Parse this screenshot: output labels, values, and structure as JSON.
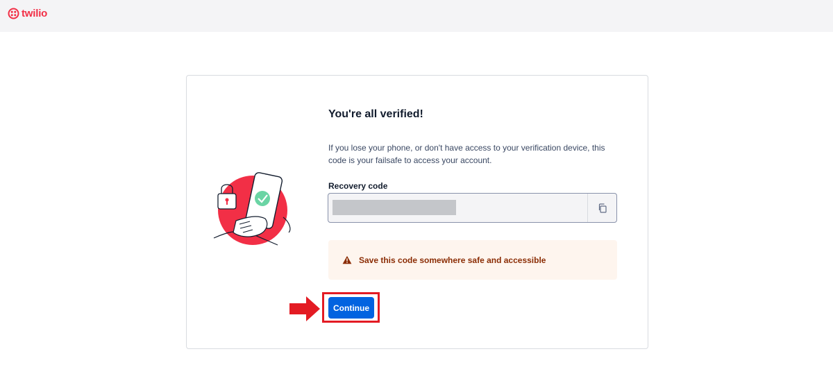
{
  "header": {
    "brand": "twilio",
    "logo_icon": "twilio-logo-icon"
  },
  "card": {
    "title": "You're all verified!",
    "description": "If you lose your phone, or don't have access to your verification device, this code is your failsafe to access your account.",
    "recovery_label": "Recovery code",
    "copy_icon": "copy-icon",
    "warning_icon": "warning-triangle-icon",
    "warning_text": "Save this code somewhere safe and accessible",
    "continue_label": "Continue"
  },
  "colors": {
    "brand_red": "#f22f46",
    "primary_blue": "#0263e0",
    "warning_bg": "#fef5ee",
    "warning_text": "#8b2d05",
    "annotation_red": "#e31b23"
  }
}
